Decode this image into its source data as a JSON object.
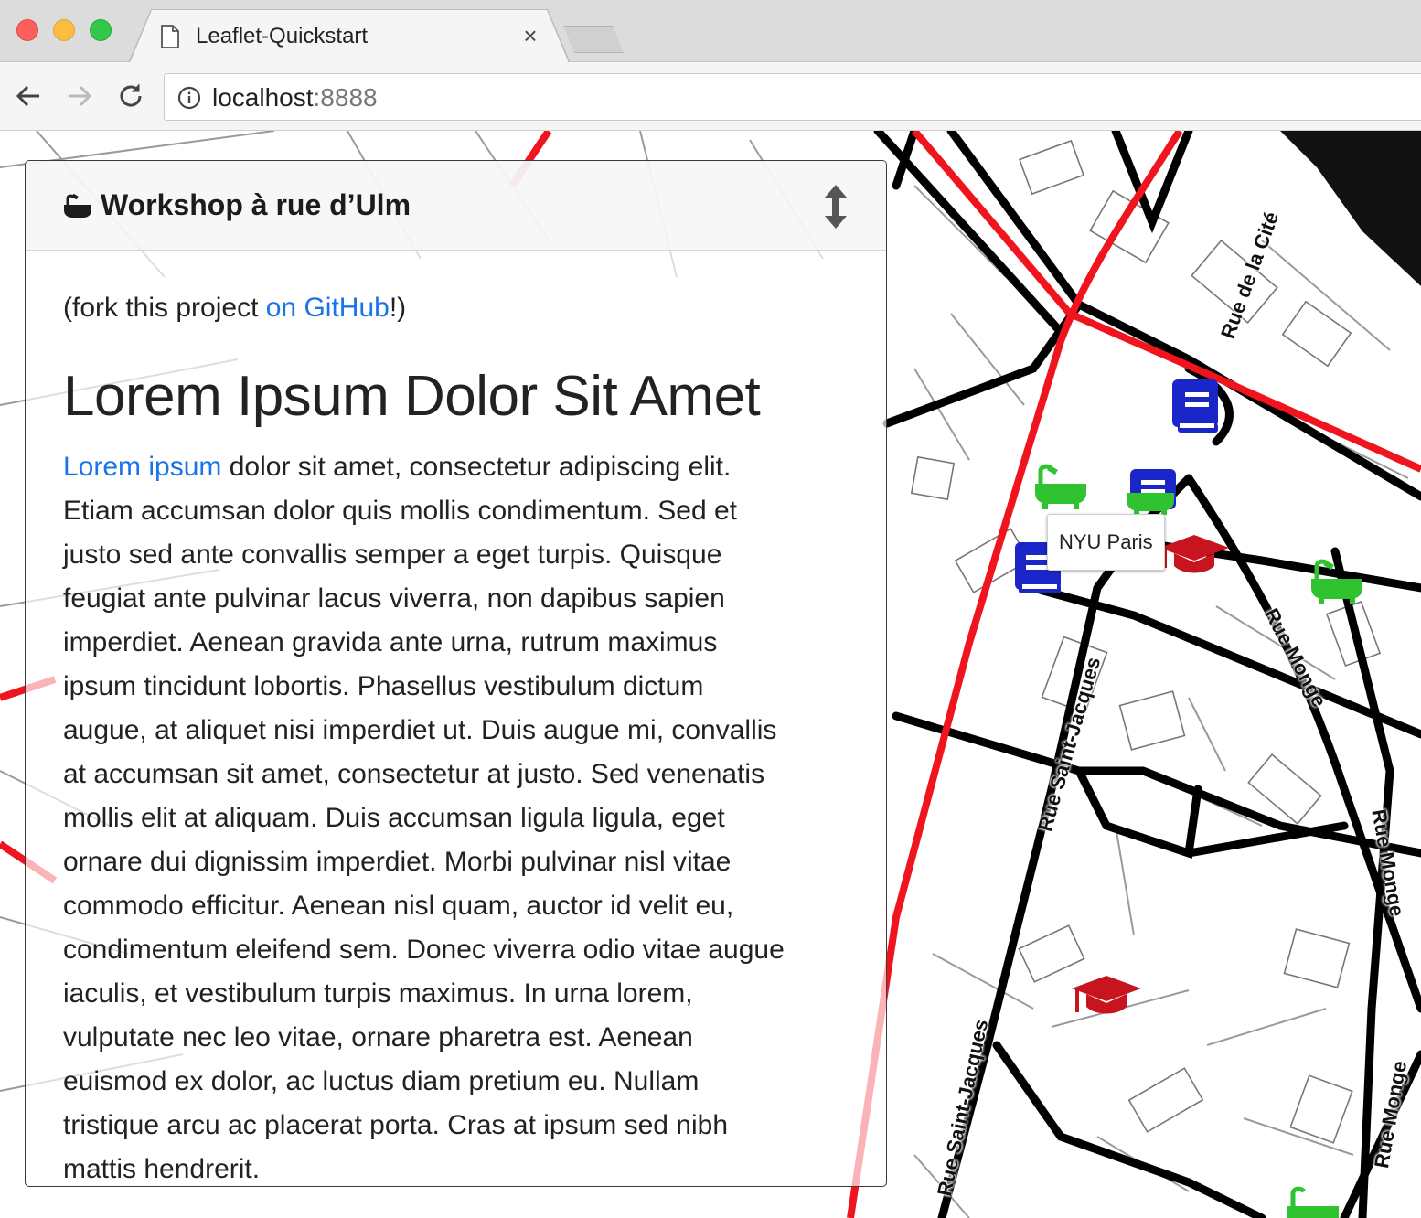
{
  "browser": {
    "tab_title": "Leaflet-Quickstart",
    "tab_close": "×",
    "url_host": "localhost",
    "url_port": ":8888"
  },
  "panel": {
    "title": "Workshop à rue d’Ulm",
    "fork_prefix": "(fork this project ",
    "fork_link": "on GitHub",
    "fork_suffix": "!)",
    "heading": "Lorem Ipsum Dolor Sit Amet",
    "lead_link": "Lorem ipsum",
    "lines": [
      " dolor sit amet, consectetur adipiscing elit.",
      "Etiam accumsan dolor quis mollis condimentum. Sed et",
      "justo sed ante convallis semper a eget turpis. Quisque",
      "feugiat ante pulvinar lacus viverra, non dapibus sapien",
      "imperdiet. Aenean gravida ante urna, rutrum maximus",
      "ipsum tincidunt lobortis. Phasellus vestibulum dictum",
      "augue, at aliquet nisi imperdiet ut. Duis augue mi, convallis",
      "at accumsan sit amet, consectetur at justo. Sed venenatis",
      "mollis elit at aliquam. Duis accumsan ligula ligula, eget",
      "ornare dui dignissim imperdiet. Morbi pulvinar nisl vitae",
      "commodo efficitur. Aenean nisl quam, auctor id velit eu,",
      "condimentum eleifend sem. Donec viverra odio vitae augue",
      "iaculis, et vestibulum turpis maximus. In urna lorem,",
      "vulputate nec leo vitae, ornare pharetra est. Aenean",
      "euismod ex dolor, ac luctus diam pretium eu. Nullam",
      "tristique arcu ac placerat porta. Cras at ipsum sed nibh",
      "mattis hendrerit."
    ]
  },
  "map": {
    "tooltip": "NYU Paris",
    "streets": {
      "cite": "Rue de la Cité",
      "monge_1": "Rue Monge",
      "monge_2": "Rue Monge",
      "monge_3": "Rue Monge",
      "saint_jacques_1": "Rue Saint-Jacques",
      "saint_jacques_2": "Rue Saint-Jacques"
    },
    "colors": {
      "library": "#1b26c8",
      "bath": "#2fc42f",
      "university": "#c8141e",
      "rail": "#f0141e"
    }
  }
}
